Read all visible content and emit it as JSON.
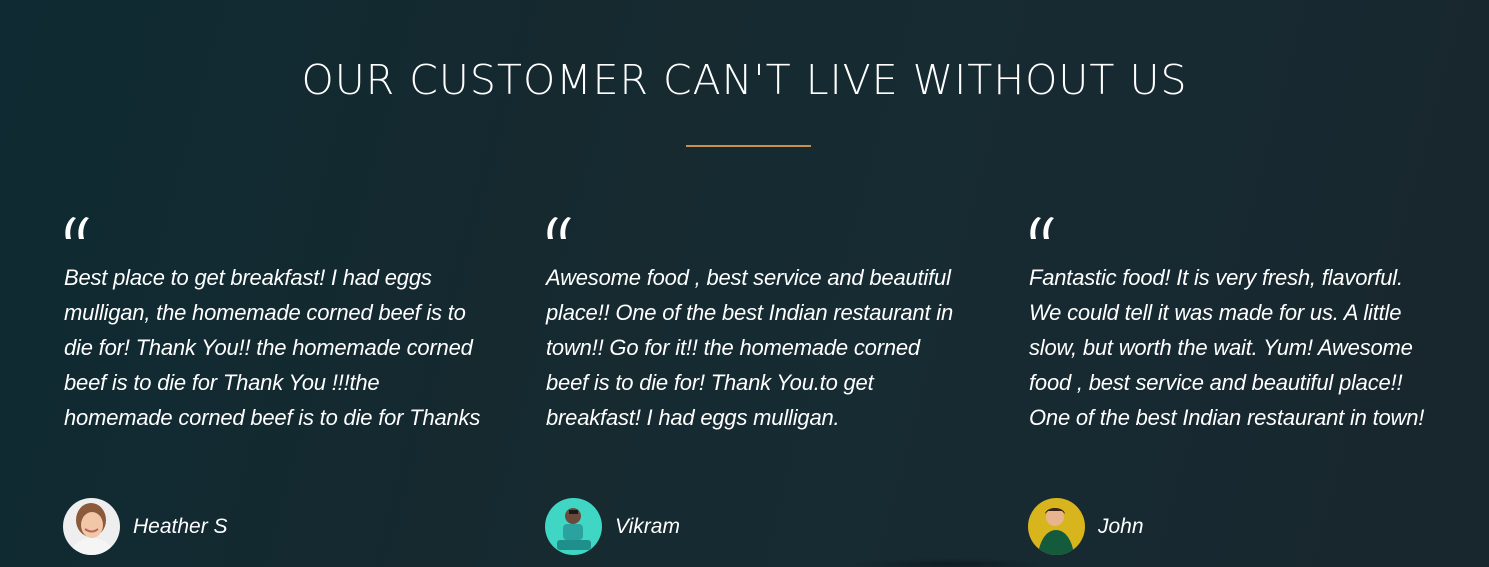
{
  "section": {
    "title": "OUR CUSTOMER CAN'T LIVE WITHOUT US"
  },
  "colors": {
    "background": "#15292f",
    "accent": "#c8904a",
    "text": "#ffffff"
  },
  "testimonials": [
    {
      "quote_icon": "quote-icon",
      "text": "Best place to get breakfast! I had eggs mulligan, the homemade corned beef is to die for! Thank You!! the homemade corned beef is to die for Thank You !!!the homemade corned beef is to die for Thanks",
      "author": "Heather S",
      "avatar_icon": "avatar"
    },
    {
      "quote_icon": "quote-icon",
      "text": "Awesome food , best service and beautiful place!! One of the best Indian restaurant in town!! Go for it!! the homemade corned beef is to die for! Thank You.to get breakfast! I had eggs mulligan.",
      "author": "Vikram",
      "avatar_icon": "avatar"
    },
    {
      "quote_icon": "quote-icon",
      "text": "Fantastic food! It is very fresh, flavorful. We could tell it was made for us. A little slow, but worth the wait. Yum! Awesome food , best service and beautiful place!! One of the best Indian restaurant in town!",
      "author": "John",
      "avatar_icon": "avatar"
    }
  ]
}
